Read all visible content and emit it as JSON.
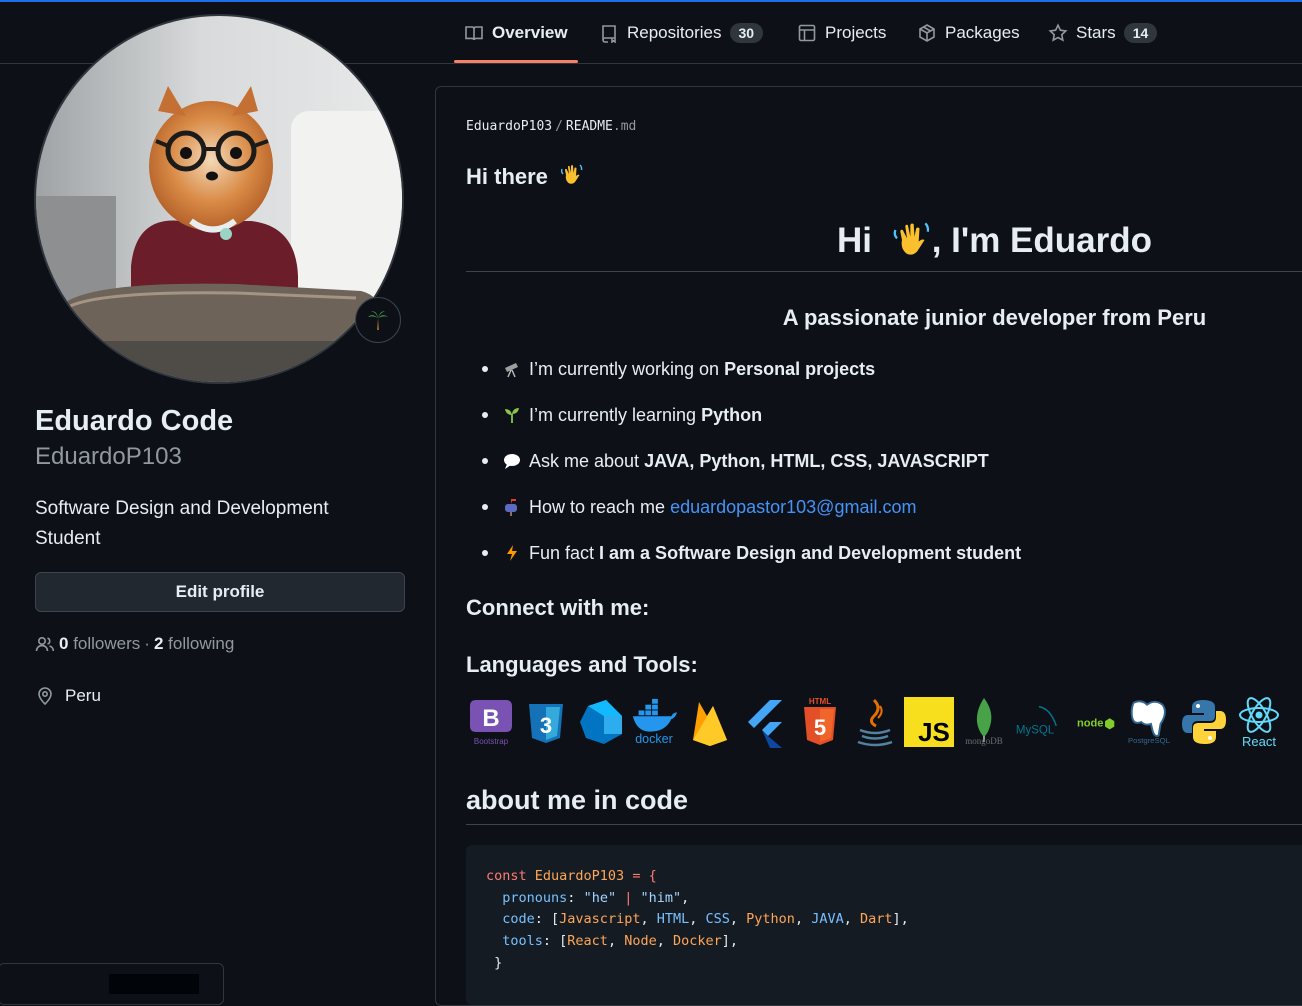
{
  "nav": {
    "tabs": [
      {
        "label": "Overview",
        "icon": "book-icon",
        "active": true
      },
      {
        "label": "Repositories",
        "icon": "repo-icon",
        "count": "30"
      },
      {
        "label": "Projects",
        "icon": "table-icon"
      },
      {
        "label": "Packages",
        "icon": "package-icon"
      },
      {
        "label": "Stars",
        "icon": "star-icon",
        "count": "14"
      }
    ]
  },
  "profile": {
    "name": "Eduardo Code",
    "username": "EduardoP103",
    "bio": "Software Design and Development Student",
    "edit_label": "Edit profile",
    "followers_count": "0",
    "followers_label": "followers",
    "separator": "·",
    "following_count": "2",
    "following_label": "following",
    "location": "Peru",
    "status_emoji": "palm-tree-icon"
  },
  "readme": {
    "crumb_user": "EduardoP103",
    "crumb_sep": "/",
    "crumb_file": "README",
    "crumb_ext": ".md",
    "greeting": "Hi there",
    "headline_pre": "Hi",
    "headline_post": ", I'm Eduardo",
    "subtitle": "A passionate junior developer from Peru",
    "facts": [
      {
        "icon": "telescope-icon",
        "text": "I’m currently working on",
        "bold": "Personal projects"
      },
      {
        "icon": "seedling-icon",
        "text": "I’m currently learning",
        "bold": "Python"
      },
      {
        "icon": "speech-bubble-icon",
        "text": "Ask me about",
        "bold": "JAVA, Python, HTML, CSS, JAVASCRIPT"
      },
      {
        "icon": "mailbox-icon",
        "text": "How to reach me",
        "link": "eduardopastor103@gmail.com"
      },
      {
        "icon": "lightning-icon",
        "text": "Fun fact",
        "bold": "I am a Software Design and Development student"
      }
    ],
    "connect_heading": "Connect with me:",
    "languages_heading": "Languages and Tools:",
    "tools": [
      {
        "name": "bootstrap-logo",
        "caption": "Bootstrap",
        "color": "#7952b3"
      },
      {
        "name": "css3-logo",
        "color": "#1572b6"
      },
      {
        "name": "dart-logo",
        "color": "#0175c2"
      },
      {
        "name": "docker-logo",
        "caption": "docker",
        "color": "#2496ed"
      },
      {
        "name": "firebase-logo",
        "color": "#ffca28"
      },
      {
        "name": "flutter-logo",
        "color": "#42a5f5"
      },
      {
        "name": "html5-logo",
        "caption": "HTML",
        "color": "#e34f26"
      },
      {
        "name": "java-logo",
        "color": "#e76f00"
      },
      {
        "name": "javascript-logo",
        "caption": "JS",
        "color": "#f7df1e"
      },
      {
        "name": "mongodb-logo",
        "caption": "mongoDB",
        "color": "#47a248"
      },
      {
        "name": "mysql-logo",
        "caption": "MySQL",
        "color": "#00758f"
      },
      {
        "name": "nodejs-logo",
        "caption": "node",
        "color": "#83cd29"
      },
      {
        "name": "postgresql-logo",
        "caption": "PostgreSQL",
        "color": "#336791"
      },
      {
        "name": "python-logo",
        "color": "#3776ab"
      },
      {
        "name": "react-logo",
        "caption": "React",
        "color": "#61dafb"
      }
    ],
    "about_heading": "about me in code",
    "code": {
      "line1_kw": "const",
      "line1_id": "EduardoP103",
      "line1_rest": " = {",
      "pronouns_key": "pronouns",
      "pronouns_v1": "\"he\"",
      "pronouns_sep": " | ",
      "pronouns_v2": "\"him\"",
      "code_key": "code",
      "code_items": [
        "Javascript",
        "HTML",
        "CSS",
        "Python",
        "JAVA",
        "Dart"
      ],
      "tools_key": "tools",
      "tools_items": [
        "React",
        "Node",
        "Docker"
      ],
      "close": "}"
    }
  },
  "colors": {
    "background": "#0d1117",
    "border": "#30363d",
    "accent_underline": "#f78166",
    "link": "#4493f8",
    "muted": "#9198a1"
  }
}
